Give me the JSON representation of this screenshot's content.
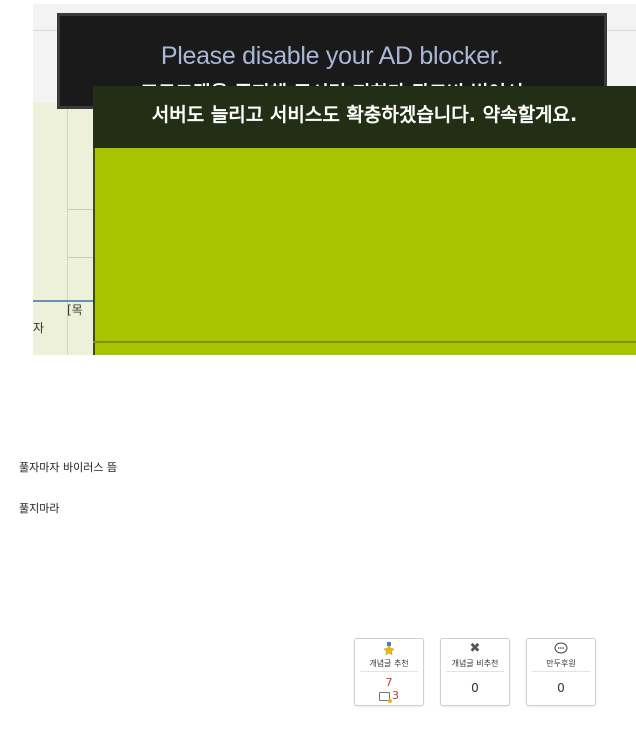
{
  "screenshot": {
    "title": "Please disable your AD blocker.",
    "message_line1": "프로그램을 중지해 주시면 저희가 광고비 벌어서",
    "message_line2": "서버도 늘리고 서비스도 확충하겠습니다. 약속할게요.",
    "side_label_top": "[목",
    "side_label_bottom": "자",
    "colors": {
      "dark_banner": "#1a1a1a",
      "green_head": "#232f14",
      "green_body": "#a8c400"
    }
  },
  "post": {
    "line1": "풀자마자 바이러스 뜸",
    "line2": "풀지마라"
  },
  "votes": {
    "recommend": {
      "icon": "star-medal-icon",
      "label": "개념글 추천",
      "count": "7",
      "sub_count": "3"
    },
    "not_recommend": {
      "icon": "x-icon",
      "label": "개념글 비추천",
      "count": "0"
    },
    "donate": {
      "icon": "smiley-bubble-icon",
      "label": "만두후원",
      "count": "0"
    }
  }
}
